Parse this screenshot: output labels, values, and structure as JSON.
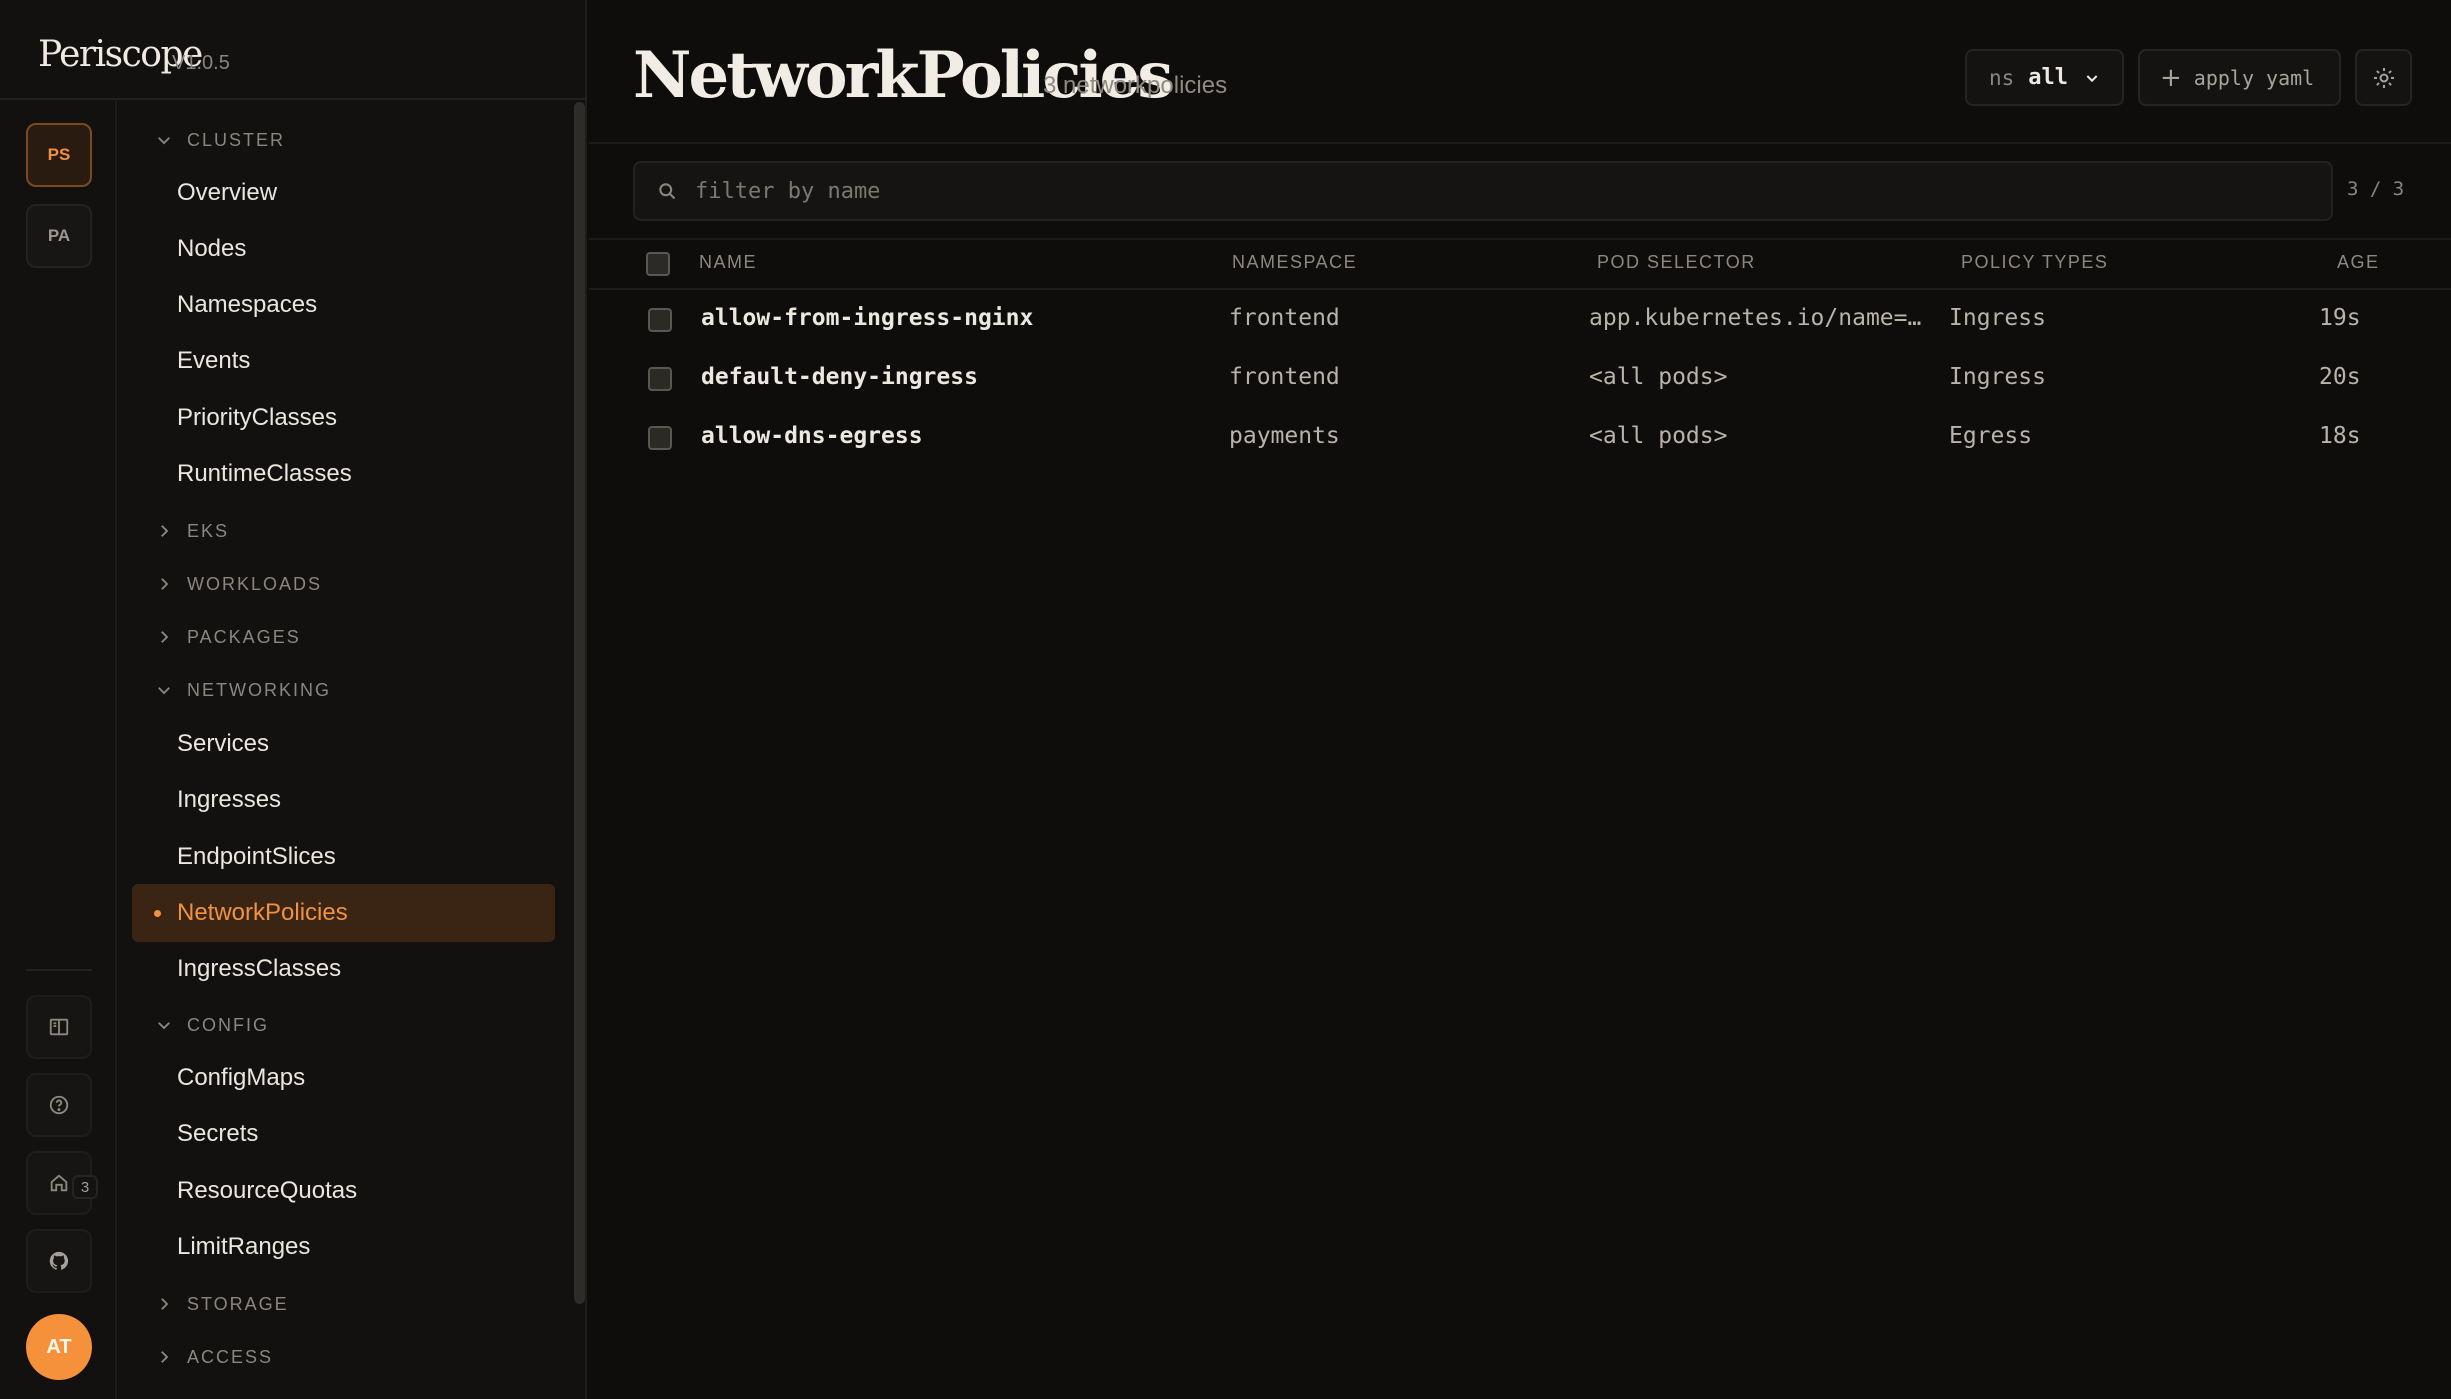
{
  "brand": {
    "name": "Periscope",
    "version": "V1.0.5"
  },
  "rail": {
    "contexts": [
      {
        "label": "PS",
        "active": true
      },
      {
        "label": "PA",
        "active": false
      }
    ],
    "buttons": [
      "book-icon",
      "help-icon",
      "home-icon",
      "github-icon"
    ],
    "github_badge": "3",
    "avatar": "AT"
  },
  "nav": {
    "sections": {
      "cluster": "CLUSTER",
      "eks": "EKS",
      "workloads": "WORKLOADS",
      "packages": "PACKAGES",
      "networking": "NETWORKING",
      "config": "CONFIG",
      "storage": "STORAGE",
      "access": "ACCESS"
    },
    "cluster_items": [
      "Overview",
      "Nodes",
      "Namespaces",
      "Events",
      "PriorityClasses",
      "RuntimeClasses"
    ],
    "networking_items": [
      "Services",
      "Ingresses",
      "EndpointSlices",
      "NetworkPolicies",
      "IngressClasses"
    ],
    "config_items": [
      "ConfigMaps",
      "Secrets",
      "ResourceQuotas",
      "LimitRanges"
    ],
    "active_item": "NetworkPolicies"
  },
  "header": {
    "title": "NetworkPolicies",
    "count": "3 networkpolicies",
    "ns_label": "ns",
    "ns_value": "all",
    "apply_label": "apply yaml"
  },
  "filter": {
    "placeholder": "filter by name",
    "count": "3 / 3"
  },
  "table": {
    "columns": [
      "NAME",
      "NAMESPACE",
      "POD SELECTOR",
      "POLICY TYPES",
      "AGE"
    ],
    "rows": [
      {
        "name": "allow-from-ingress-nginx",
        "namespace": "frontend",
        "pod_selector": "app.kubernetes.io/name=ingress-nginx",
        "policy_types": "Ingress",
        "age": "19s"
      },
      {
        "name": "default-deny-ingress",
        "namespace": "frontend",
        "pod_selector": "<all pods>",
        "policy_types": "Ingress",
        "age": "20s"
      },
      {
        "name": "allow-dns-egress",
        "namespace": "payments",
        "pod_selector": "<all pods>",
        "policy_types": "Egress",
        "age": "18s"
      }
    ]
  },
  "colors": {
    "accent": "#f0923f",
    "background": "#0e0d0c",
    "sidebar": "#121110",
    "active_bg": "#3a2514"
  }
}
